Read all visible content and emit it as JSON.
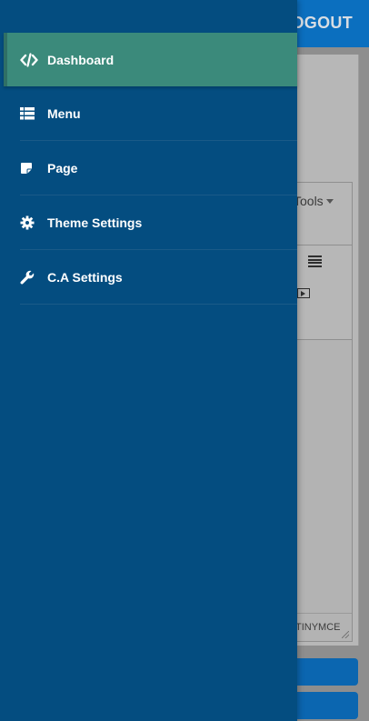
{
  "header": {
    "logout_label": "LOGOUT"
  },
  "editor": {
    "tools_label": "Tools",
    "statusbar_label": "TINYMCE"
  },
  "sidebar": {
    "items": [
      {
        "label": "Dashboard",
        "icon": "code-icon",
        "active": true
      },
      {
        "label": "Menu",
        "icon": "list-icon",
        "active": false
      },
      {
        "label": "Page",
        "icon": "sticky-note-icon",
        "active": false
      },
      {
        "label": "Theme Settings",
        "icon": "gear-icon",
        "active": false
      },
      {
        "label": "C.A Settings",
        "icon": "wrench-icon",
        "active": false
      }
    ]
  },
  "colors": {
    "drawer_bg": "#044d80",
    "active_item_bg": "#3b8a7b",
    "header_bg": "#0b6fbf"
  }
}
